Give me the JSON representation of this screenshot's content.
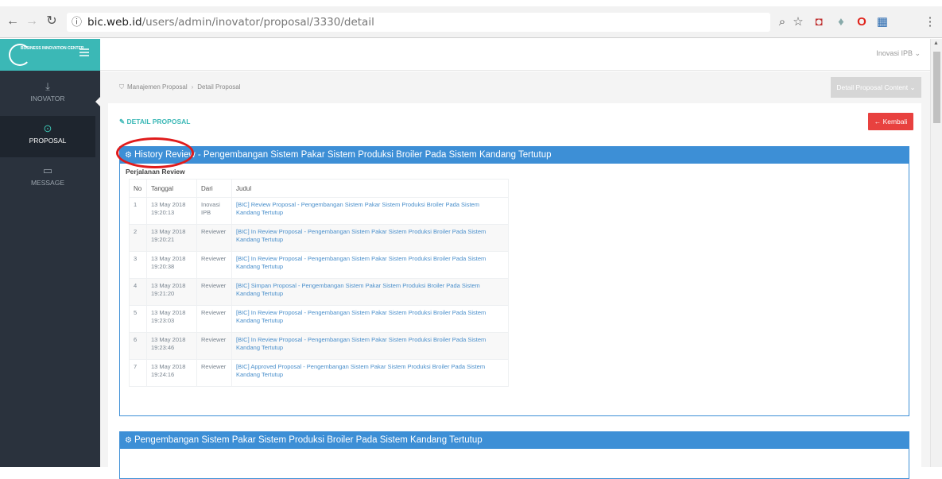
{
  "browser": {
    "url_prefix": "bic.web.id",
    "url_path": "/users/admin/inovator/proposal/3330/detail"
  },
  "app": {
    "logo_text": "BUSINESS INNOVATION CENTER",
    "user_menu": "Inovasi IPB ⌄"
  },
  "sidebar": {
    "items": [
      {
        "label": "INOVATOR",
        "icon": "download-icon"
      },
      {
        "label": "PROPOSAL",
        "icon": "arrow-up-circle-icon"
      },
      {
        "label": "MESSAGE",
        "icon": "inbox-icon"
      }
    ]
  },
  "breadcrumb": {
    "items": [
      "Manajemen Proposal",
      "Detail Proposal"
    ],
    "dropdown": "Detail Proposal Content ⌄"
  },
  "page": {
    "section_title": "DETAIL PROPOSAL",
    "back_button": "Kembali"
  },
  "history": {
    "header_label": "History Review",
    "header_rest": "- Pengembangan Sistem Pakar Sistem Produksi Broiler Pada Sistem Kandang Tertutup",
    "subtitle": "Perjalanan Review",
    "columns": [
      "No",
      "Tanggal",
      "Dari",
      "Judul"
    ],
    "rows": [
      {
        "no": "1",
        "date": "13 May 2018",
        "time": "19:20:13",
        "dari": "Inovasi IPB",
        "judul": "[BIC] Review Proposal - Pengembangan Sistem Pakar Sistem Produksi Broiler Pada Sistem Kandang Tertutup"
      },
      {
        "no": "2",
        "date": "13 May 2018",
        "time": "19:20:21",
        "dari": "Reviewer",
        "judul": "[BIC] In Review Proposal - Pengembangan Sistem Pakar Sistem Produksi Broiler Pada Sistem Kandang Tertutup"
      },
      {
        "no": "3",
        "date": "13 May 2018",
        "time": "19:20:38",
        "dari": "Reviewer",
        "judul": "[BIC] In Review Proposal - Pengembangan Sistem Pakar Sistem Produksi Broiler Pada Sistem Kandang Tertutup"
      },
      {
        "no": "4",
        "date": "13 May 2018",
        "time": "19:21:20",
        "dari": "Reviewer",
        "judul": "[BIC] Simpan Proposal - Pengembangan Sistem Pakar Sistem Produksi Broiler Pada Sistem Kandang Tertutup"
      },
      {
        "no": "5",
        "date": "13 May 2018",
        "time": "19:23:03",
        "dari": "Reviewer",
        "judul": "[BIC] In Review Proposal - Pengembangan Sistem Pakar Sistem Produksi Broiler Pada Sistem Kandang Tertutup"
      },
      {
        "no": "6",
        "date": "13 May 2018",
        "time": "19:23:46",
        "dari": "Reviewer",
        "judul": "[BIC] In Review Proposal - Pengembangan Sistem Pakar Sistem Produksi Broiler Pada Sistem Kandang Tertutup"
      },
      {
        "no": "7",
        "date": "13 May 2018",
        "time": "19:24:16",
        "dari": "Reviewer",
        "judul": "[BIC] Approved Proposal - Pengembangan Sistem Pakar Sistem Produksi Broiler Pada Sistem Kandang Tertutup"
      }
    ]
  },
  "content_box": {
    "header": "Pengembangan Sistem Pakar Sistem Produksi Broiler Pada Sistem Kandang Tertutup"
  },
  "colors": {
    "accent": "#3bb8b6",
    "header_blue": "#3d8fd6",
    "danger": "#e8413f",
    "annotation": "#e01b1b"
  }
}
